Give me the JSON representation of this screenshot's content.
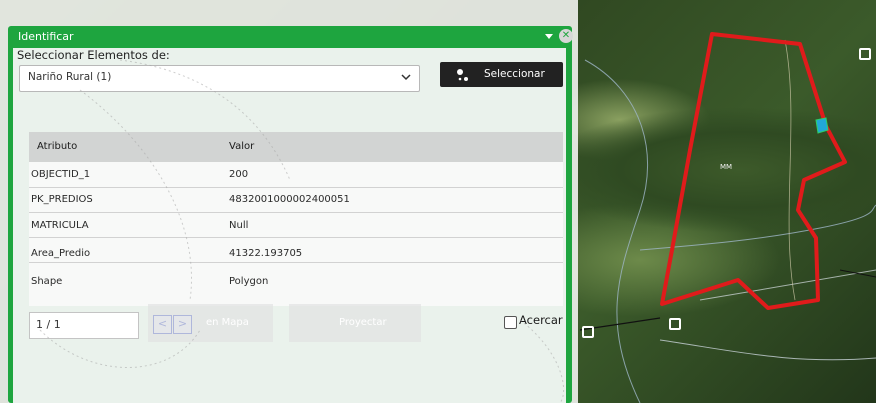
{
  "dialog": {
    "title": "Identificar",
    "select_label": "Seleccionar Elementos de:",
    "layer_value": "Nariño Rural (1)",
    "select_button": "Seleccionar"
  },
  "table": {
    "headers": [
      "Atributo",
      "Valor"
    ],
    "rows": [
      {
        "attr": "OBJECTID_1",
        "value": "200"
      },
      {
        "attr": "PK_PREDIOS",
        "value": "4832001000002400051"
      },
      {
        "attr": "MATRICULA",
        "value": "Null"
      },
      {
        "attr": "Area_Predio",
        "value": "41322.193705"
      },
      {
        "attr": "Shape",
        "value": "Polygon"
      }
    ]
  },
  "footer": {
    "pager": "1 / 1",
    "prev": "<",
    "next": ">",
    "ghost_left": "en Mapa",
    "ghost_right": "Proyectar",
    "zoom_label": "Acercar"
  },
  "map": {
    "parcel_label": "MM",
    "parcel_color": "#e01b1b",
    "accent": "#1ea53f"
  }
}
